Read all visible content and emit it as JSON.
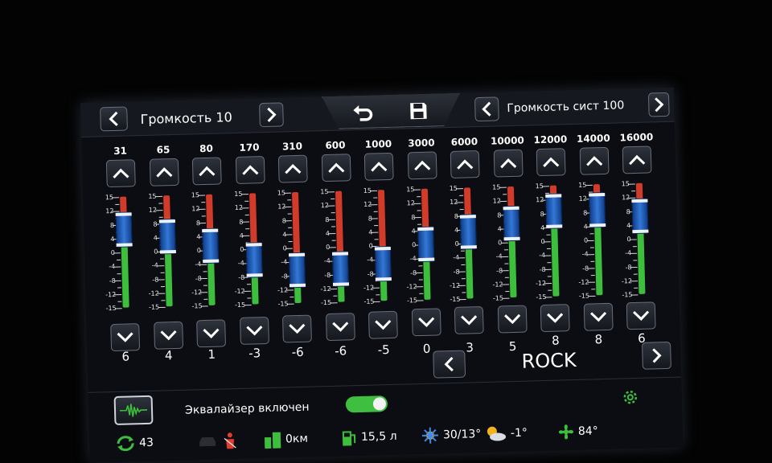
{
  "header": {
    "left_volume_label": "Громкость 10",
    "right_volume_label": "Громкость сист 100"
  },
  "equalizer": {
    "scale_labels": [
      "15",
      "12",
      "8",
      "4",
      "0",
      "-4",
      "-8",
      "-12",
      "-15"
    ],
    "bands": [
      {
        "freq": "31",
        "value": "6",
        "level": 6
      },
      {
        "freq": "65",
        "value": "4",
        "level": 4
      },
      {
        "freq": "80",
        "value": "1",
        "level": 1
      },
      {
        "freq": "170",
        "value": "-3",
        "level": -3
      },
      {
        "freq": "310",
        "value": "-6",
        "level": -6
      },
      {
        "freq": "600",
        "value": "-6",
        "level": -6
      },
      {
        "freq": "1000",
        "value": "-5",
        "level": -5
      },
      {
        "freq": "3000",
        "value": "0",
        "level": 0
      },
      {
        "freq": "6000",
        "value": "3",
        "level": 3
      },
      {
        "freq": "10000",
        "value": "5",
        "level": 5
      },
      {
        "freq": "12000",
        "value": "8",
        "level": 8
      },
      {
        "freq": "14000",
        "value": "8",
        "level": 8
      },
      {
        "freq": "16000",
        "value": "6",
        "level": 6
      }
    ],
    "preset_name": "ROCK",
    "enabled_label": "Эквалайзер включен",
    "enabled": true
  },
  "status": {
    "sync_value": "43",
    "distance": "0км",
    "fuel": "15,5 л",
    "climate": "30/13°",
    "outside_temp": "-1°",
    "humidity": "84°"
  },
  "colors": {
    "accent_blue": "#2f6fd0",
    "meter_green": "#3dbf3d",
    "meter_red": "#d23a2a",
    "toggle_green": "#3fbf3f"
  }
}
